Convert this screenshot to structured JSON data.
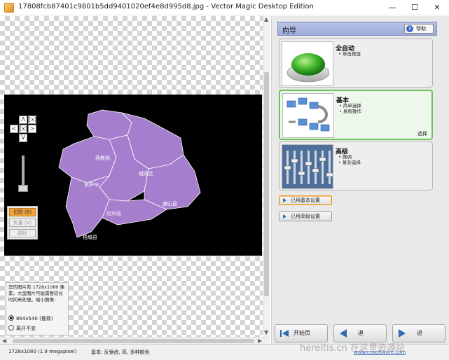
{
  "window": {
    "title": "17808fcb87401c9801b5dd9401020ef4e8d995d8.jpg - Vector Magic Desktop Edition",
    "minimize": "—",
    "maximize": "☐",
    "close": "✕"
  },
  "canvas": {
    "map_labels": [
      "燕教则",
      "东萨州",
      "城双区",
      "应州站",
      "速山县",
      "梧城县"
    ],
    "region_color": "#a57fcd"
  },
  "nav": {
    "up": "Λ",
    "down": "V",
    "left": "<",
    "right": ">",
    "fit": "[x]",
    "center": "[x]"
  },
  "modes": {
    "bitmap": "位图 (B)",
    "vector": "矢量 (V)",
    "path": "路径"
  },
  "info": {
    "text": "您的图片有 1728x1080 像素。大型图片可能需要较长时间来处理。缩小图像:",
    "option_1": "864x540 (推荐)",
    "option_2": "离开不变",
    "selected_option": 1
  },
  "wizard": {
    "header": "向导",
    "help": "帮助",
    "options": [
      {
        "title": "全自动",
        "bullets": [
          "单击按钮"
        ],
        "icon": "green-button-icon"
      },
      {
        "title": "基本",
        "bullets": [
          "简单选择",
          "易规操作"
        ],
        "icon": "workflow-icon",
        "selected_label": "选择"
      },
      {
        "title": "高级",
        "bullets": [
          "微调",
          "复杂选择"
        ],
        "icon": "mixer-console-icon"
      }
    ],
    "buttons": {
      "basic_settings": "已用基本设置",
      "advanced_settings": "已用高级设置"
    },
    "nav": {
      "start": "开始页",
      "back": "退",
      "next": "进"
    }
  },
  "status": {
    "size": "1728x1080 (1.9 megapixel)",
    "mode": "基本: 反锯齿, 高, 多种颜色",
    "link": "www.cnsoftware.com",
    "watermark": "hereitis.cn 在这里资源站"
  },
  "colors": {
    "accent": "#6cc35a",
    "bitmap_mode": "#f3a43b",
    "header": "#a5b1dd"
  }
}
